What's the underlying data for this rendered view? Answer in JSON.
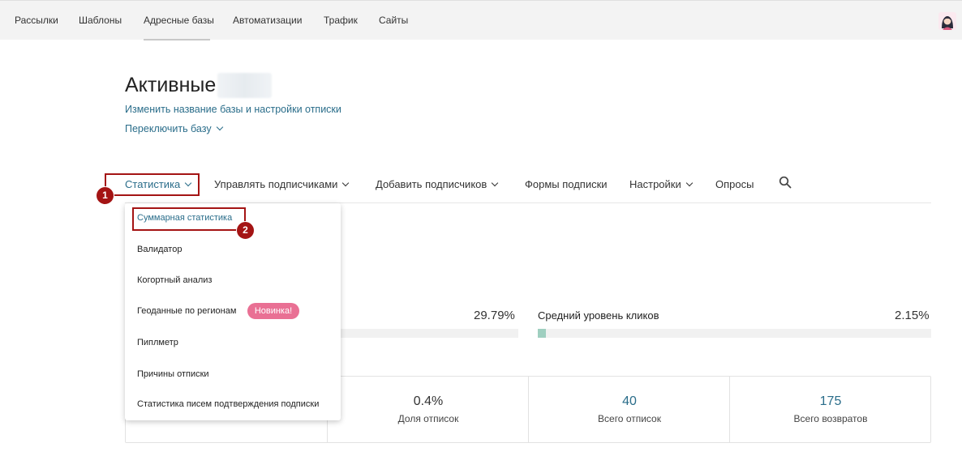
{
  "topnav": {
    "items": [
      "Рассылки",
      "Шаблоны",
      "Адресные базы",
      "Автоматизации",
      "Трафик",
      "Сайты"
    ],
    "active": "Адресные базы"
  },
  "header": {
    "title": "Активные",
    "rename_link": "Изменить название базы и настройки отписки",
    "switch_link": "Переключить базу"
  },
  "tabs": [
    "Статистика",
    "Управлять подписчиками",
    "Добавить подписчиков",
    "Формы подписки",
    "Настройки",
    "Опросы"
  ],
  "dropdown": {
    "items": [
      "Суммарная статистика",
      "Валидатор",
      "Когортный анализ",
      "Геоданные по регионам",
      "Пиплметр",
      "Причины отписки",
      "Статистика писем подтверждения подписки"
    ],
    "new_badge": "Новинка!"
  },
  "annotations": {
    "step1": "1",
    "step2": "2"
  },
  "stats": {
    "open_rate_pct": "29.79%",
    "open_rate_value": 29.79,
    "click_label": "Средний уровень кликов",
    "click_rate_pct": "2.15%",
    "click_rate_value": 2.15
  },
  "cards": [
    {
      "value": "0.4%",
      "label": "Доля отписок"
    },
    {
      "value": "40",
      "label": "Всего отписок"
    },
    {
      "value": "175",
      "label": "Всего возвратов"
    }
  ],
  "colors": {
    "link": "#2a6d8a",
    "annotation": "#a41414",
    "badge": "#e97094",
    "bar_fill": "#9fcfc0"
  }
}
